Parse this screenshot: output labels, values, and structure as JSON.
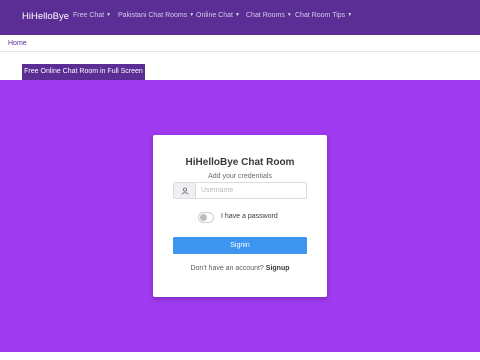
{
  "navbar": {
    "brand": "HiHelloBye",
    "items": [
      {
        "label": "Free Chat"
      },
      {
        "label": "Pakistani Chat Rooms"
      },
      {
        "label": "Online Chat"
      },
      {
        "label": "Chat Rooms"
      },
      {
        "label": "Chat Room Tips"
      }
    ],
    "dropdown_icon": "caret-down-icon"
  },
  "breadcrumb": {
    "home": "Home"
  },
  "fullscreen_tab": "Free Online Chat Room in Full Screen",
  "login_card": {
    "title": "HiHelloBye Chat Room",
    "subtitle": "Add your credentials",
    "username_icon": "user-icon",
    "username_placeholder": "Username",
    "username_value": "",
    "password_toggle_label": "I have a password",
    "password_toggle_on": false,
    "signin_label": "Signin",
    "signup_prompt": "Don't have an account?",
    "signup_link": "Signup"
  },
  "colors": {
    "navbar": "#5b2e95",
    "hero_background": "#a13bf2",
    "signin_button": "#3e95f0"
  }
}
